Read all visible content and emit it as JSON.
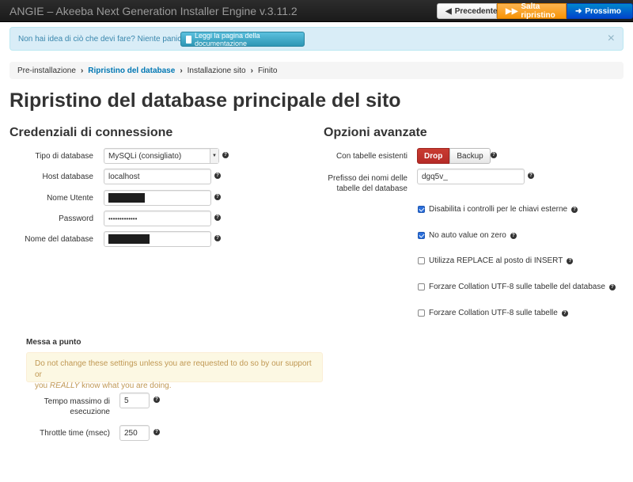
{
  "header": {
    "title": "ANGIE – Akeeba Next Generation Installer Engine v.3.11.2",
    "prev_label": "Precedente",
    "skip_label": "Salta ripristino",
    "next_label": "Prossimo"
  },
  "info": {
    "text": "Non hai idea di ciò che devi fare? Niente panico!",
    "doc_button": "Leggi la pagina della documentazione",
    "close": "×"
  },
  "breadcrumb": [
    "Pre-installazione",
    "Ripristino del database",
    "Installazione sito",
    "Finito"
  ],
  "page_title": "Ripristino del database principale del sito",
  "connection": {
    "heading": "Credenziali di connessione",
    "db_type_label": "Tipo di database",
    "db_type_value": "MySQLi (consigliato)",
    "host_label": "Host database",
    "host_value": "localhost",
    "user_label": "Nome Utente",
    "password_label": "Password",
    "password_value": "•••••••••••••",
    "dbname_label": "Nome del database"
  },
  "advanced": {
    "heading": "Opzioni avanzate",
    "existing_label": "Con tabelle esistenti",
    "drop_label": "Drop",
    "backup_label": "Backup",
    "prefix_label_1": "Prefisso dei nomi delle",
    "prefix_label_2": "tabelle del database",
    "prefix_value": "dgq5v_",
    "options": [
      {
        "label": "Disabilita i controlli per le chiavi esterne",
        "checked": true
      },
      {
        "label": "No auto value on zero",
        "checked": true
      },
      {
        "label": "Utilizza REPLACE al posto di INSERT",
        "checked": false
      },
      {
        "label": "Forzare Collation UTF-8 sulle tabelle del database",
        "checked": false
      },
      {
        "label": "Forzare Collation UTF-8 sulle tabelle",
        "checked": false
      }
    ]
  },
  "debug": {
    "heading": "Messa a punto",
    "warning_1": "Do not change these settings unless you are requested to do so by our support or",
    "warning_2a": "you ",
    "warning_2b": "REALLY",
    "warning_2c": " know what you are doing.",
    "max_time_label_1": "Tempo massimo di",
    "max_time_label_2": "esecuzione",
    "max_time_value": "5",
    "throttle_label": "Throttle time (msec)",
    "throttle_value": "250"
  },
  "colors": {
    "skip": "#f89406",
    "next": "#0044cc",
    "drop": "#b52b27",
    "breadcrumb_active": "#0077b3"
  }
}
